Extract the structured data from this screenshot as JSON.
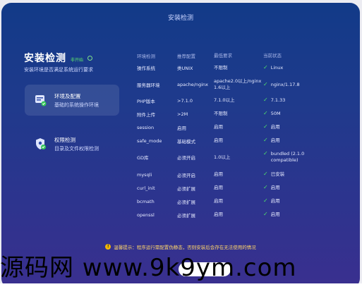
{
  "window": {
    "title": "安装检测"
  },
  "left": {
    "title": "安装检测",
    "badge": "非开始",
    "desc": "安装环境是否满足系统运行要求"
  },
  "nav": [
    {
      "line1": "环境及配置",
      "line2": "基础的系统操作环境",
      "icon": "server-icon",
      "active": true
    },
    {
      "line1": "权限检测",
      "line2": "目录及文件权限检测",
      "icon": "shield-icon",
      "active": false
    }
  ],
  "table": {
    "headers": [
      "环境检测",
      "推荐配置",
      "最低要求",
      "当前状态"
    ],
    "rows": [
      {
        "name": "操作系统",
        "rec": "类UNIX",
        "min": "不限制",
        "cur": "Linux"
      },
      {
        "name": "服务器环境",
        "rec": "apache/nginx",
        "min": "apache2.0以上/nginx1.6以上",
        "cur": "nginx/1.17.8"
      },
      {
        "name": "PHP版本",
        "rec": ">7.1.0",
        "min": "7.1.0以上",
        "cur": "7.1.33"
      },
      {
        "name": "附件上传",
        "rec": ">2M",
        "min": "不限制",
        "cur": "50M"
      },
      {
        "name": "session",
        "rec": "启用",
        "min": "启用",
        "cur": "启用"
      },
      {
        "name": "safe_mode",
        "rec": "基础模式",
        "min": "启用",
        "cur": "启用"
      },
      {
        "name": "GD库",
        "rec": "必须开启",
        "min": "1.0以上",
        "cur": "bundled (2.1.0 compatible)"
      },
      {
        "name": "mysqli",
        "rec": "必须开启",
        "min": "启用",
        "cur": "已安装"
      },
      {
        "name": "curl_init",
        "rec": "必须扩展",
        "min": "启用",
        "cur": "启用"
      },
      {
        "name": "bcmath",
        "rec": "必须扩展",
        "min": "启用",
        "cur": "启用"
      },
      {
        "name": "openssl",
        "rec": "必须扩展",
        "min": "启用",
        "cur": "启用"
      }
    ]
  },
  "notice": "温馨提示：程序运行需配置伪静态，否则安装后会存在无法使用的情况",
  "watermark": "源码网 www.9k9ym.com",
  "colors": {
    "ok": "#4fe06a",
    "warn": "#f2b705"
  }
}
